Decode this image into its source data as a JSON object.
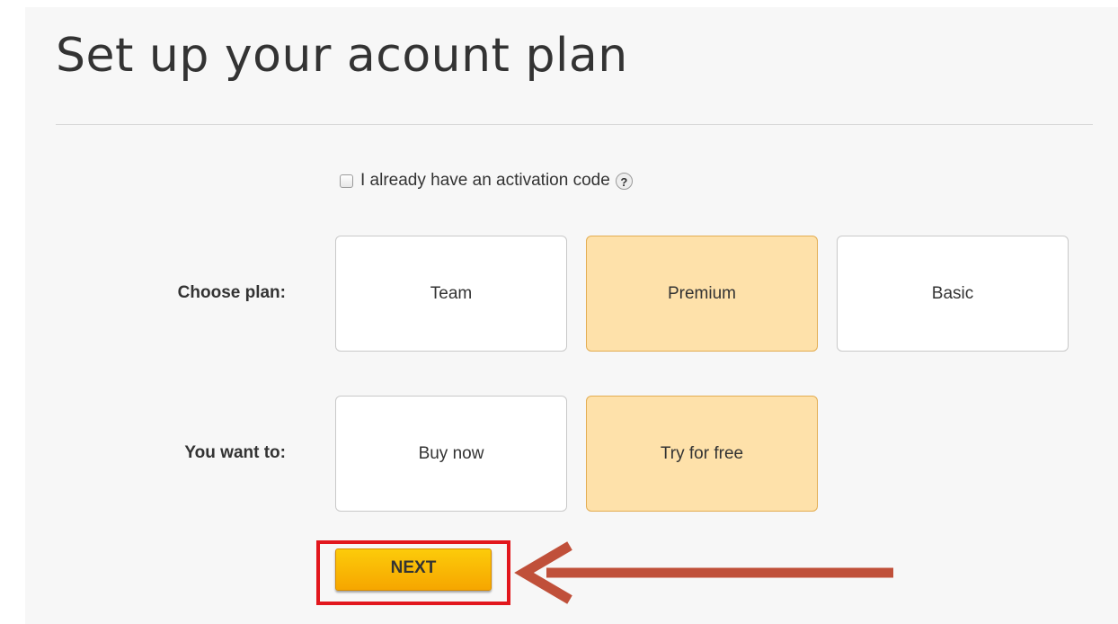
{
  "title": "Set up your acount plan",
  "activation": {
    "label": "I already have an activation code",
    "help_glyph": "?",
    "checked": false
  },
  "plan": {
    "label": "Choose plan:",
    "options": [
      "Team",
      "Premium",
      "Basic"
    ],
    "selected": "Premium"
  },
  "purchase": {
    "label": "You want to:",
    "options": [
      "Buy now",
      "Try for free"
    ],
    "selected": "Try for free"
  },
  "next_button": {
    "label": "NEXT"
  },
  "annotation": {
    "highlight_color": "#e2171d",
    "arrow_color": "#c0503a"
  },
  "colors": {
    "selected_fill": "#fee1aa",
    "selected_border": "#e3ad52",
    "button_fill": "#f9b800"
  }
}
